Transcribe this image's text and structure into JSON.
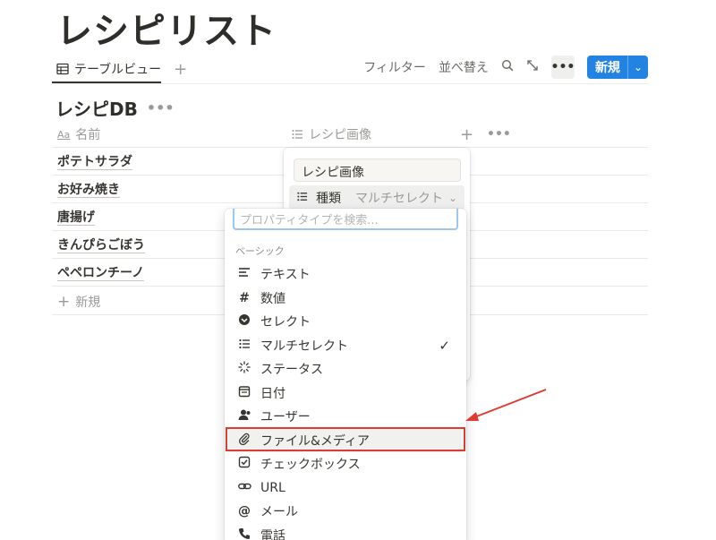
{
  "page": {
    "title": "レシピリスト"
  },
  "tabs": {
    "active_label": "テーブルビュー",
    "add_symbol": "+"
  },
  "toolbar": {
    "filter": "フィルター",
    "sort": "並べ替え",
    "new_label": "新規",
    "more": "•••"
  },
  "database": {
    "title": "レシピDB",
    "more": "•••"
  },
  "columns": {
    "name_prefix": "Aa",
    "name": "名前",
    "image": "レシピ画像",
    "add": "+",
    "more": "•••"
  },
  "rows": [
    "ポテトサラダ",
    "お好み焼き",
    "唐揚げ",
    "きんぴらごぼう",
    "ペペロンチーノ"
  ],
  "new_row": {
    "label": "新規",
    "plus": "+"
  },
  "property_panel": {
    "name_value": "レシピ画像",
    "type_key": "種類",
    "type_value": "マルチセレクト"
  },
  "type_menu": {
    "search_placeholder": "プロパティタイプを検索...",
    "section": "ベーシック",
    "items": [
      {
        "icon": "text-icon",
        "label": "テキスト"
      },
      {
        "icon": "number-icon",
        "label": "数値"
      },
      {
        "icon": "select-icon",
        "label": "セレクト"
      },
      {
        "icon": "multiselect-icon",
        "label": "マルチセレクト",
        "checked": true
      },
      {
        "icon": "status-icon",
        "label": "ステータス"
      },
      {
        "icon": "date-icon",
        "label": "日付"
      },
      {
        "icon": "user-icon",
        "label": "ユーザー"
      },
      {
        "icon": "attachment-icon",
        "label": "ファイル&メディア",
        "highlighted": true
      },
      {
        "icon": "checkbox-icon",
        "label": "チェックボックス"
      },
      {
        "icon": "url-icon",
        "label": "URL"
      },
      {
        "icon": "email-icon",
        "label": "メール"
      },
      {
        "icon": "phone-icon",
        "label": "電話"
      }
    ]
  },
  "colors": {
    "accent": "#2383e2",
    "annotation": "#e03b2f",
    "text": "#37352f",
    "muted": "#9b9a97"
  }
}
